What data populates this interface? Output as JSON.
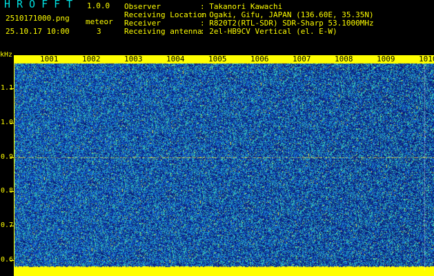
{
  "header": {
    "title": "HROFFT",
    "version": "1.0.0",
    "filename": "2510171000.png",
    "datetime": "25.10.17 10:00",
    "meteor_label": "meteor",
    "meteor_count": "3",
    "fields": [
      {
        "key": "Observer",
        "value": ": Takanori Kawachi"
      },
      {
        "key": "Receiving Location",
        "value": ": Ogaki, Gifu, JAPAN (136.60E, 35.35N)"
      },
      {
        "key": "Receiver",
        "value": ": R820T2(RTL-SDR) SDR-Sharp 53.1000MHz"
      },
      {
        "key": "Receiving antenna",
        "value": ": 2el-HB9CV Vertical (el. E-W)"
      }
    ]
  },
  "axes": {
    "y_unit": "kHz",
    "y_ticks": [
      "1.1",
      "1.0",
      "0.9",
      "0.8",
      "0.7",
      "0.6"
    ],
    "x_ticks": [
      "1001",
      "1002",
      "1003",
      "1004",
      "1005",
      "1006",
      "1007",
      "1008",
      "1009",
      "1010"
    ]
  },
  "colors": {
    "accent": "#ffff00",
    "title": "#00e0e0",
    "background": "#000000",
    "noise_dark": "#0a2a8a",
    "noise_mid": "#1a5fd0",
    "noise_light": "#20b0c8"
  }
}
